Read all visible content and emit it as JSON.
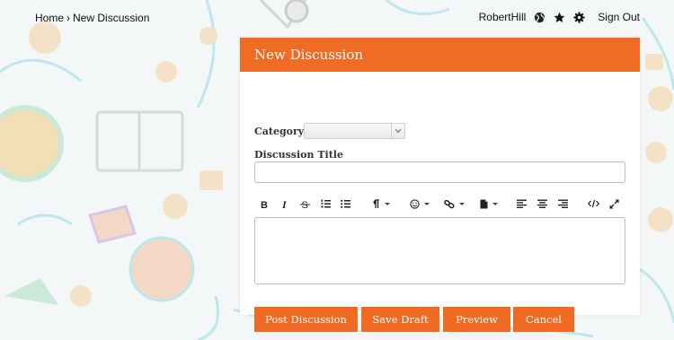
{
  "breadcrumb": {
    "home": "Home",
    "separator": "›",
    "current": "New Discussion"
  },
  "user": {
    "name": "RobertHill",
    "icons": [
      "globe-icon",
      "star-icon",
      "gear-icon"
    ],
    "sign_out": "Sign Out"
  },
  "panel": {
    "title": "New Discussion",
    "category_label": "Category",
    "category_value": "",
    "discussion_title_label": "Discussion Title",
    "discussion_title_value": "",
    "body_value": ""
  },
  "toolbar": [
    "bold-icon",
    "italic-icon",
    "strikethrough-icon",
    "ordered-list-icon",
    "unordered-list-icon",
    "paragraph-format-icon",
    "emoji-icon",
    "link-icon",
    "file-icon",
    "align-left-icon",
    "align-center-icon",
    "align-right-icon",
    "code-icon",
    "fullscreen-icon"
  ],
  "buttons": {
    "post": "Post Discussion",
    "save_draft": "Save Draft",
    "preview": "Preview",
    "cancel": "Cancel"
  },
  "colors": {
    "accent": "#ef6a22",
    "header": "#f06b24",
    "background_art": "#7fd3e6"
  }
}
